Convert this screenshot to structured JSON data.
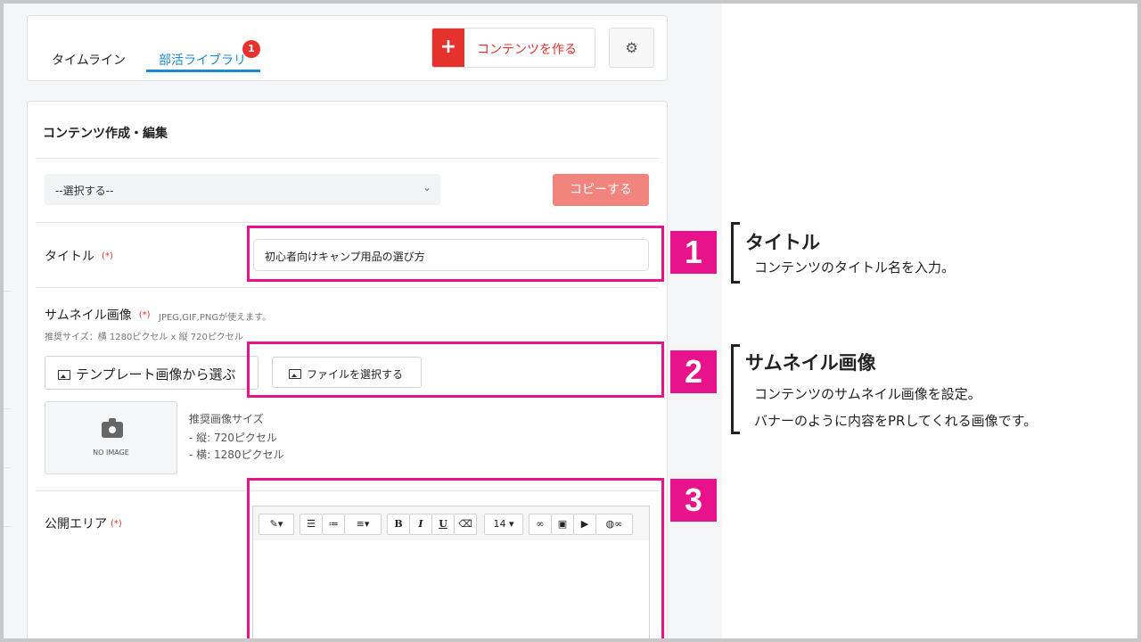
{
  "tabs": {
    "timeline": "タイムライン",
    "library": "部活ライブラリ",
    "library_badge": "1"
  },
  "header": {
    "create_icon": "plus-icon",
    "create_label": "コンテンツを作る",
    "settings_icon": "gear-icon"
  },
  "form": {
    "section_title": "コンテンツ作成・編集",
    "select_value": "--選択する--",
    "copy_label": "コピーする",
    "required_mark": "(*)",
    "title_label": "タイトル",
    "title_value": "初心者向けキャンプ用品の選び方",
    "thumb_label": "サムネイル画像",
    "thumb_formats": "JPEG,GIF,PNGが使えます。",
    "thumb_recommend": "推奨サイズ：横 1280ピクセル x 縦 720ピクセル",
    "template_btn": "テンプレート画像から選ぶ",
    "file_btn": "ファイルを選択する",
    "noimage": "NO IMAGE",
    "rec_title": "推奨画像サイズ",
    "rec_h": "- 縦: 720ピクセル",
    "rec_w": "- 横: 1280ピクセル",
    "area_label": "公開エリア",
    "font_size": "14"
  },
  "annotations": [
    {
      "num": "1",
      "title": "タイトル",
      "desc": [
        "コンテンツのタイトル名を入力。"
      ]
    },
    {
      "num": "2",
      "title": "サムネイル画像",
      "desc": [
        "コンテンツのサムネイル画像を設定。",
        "バナーのように内容をPRしてくれる画像です。"
      ]
    },
    {
      "num": "3"
    }
  ],
  "colors": {
    "accent_red": "#e5322d",
    "link_blue": "#1a8ad4",
    "highlight_pink": "#e8128c"
  }
}
